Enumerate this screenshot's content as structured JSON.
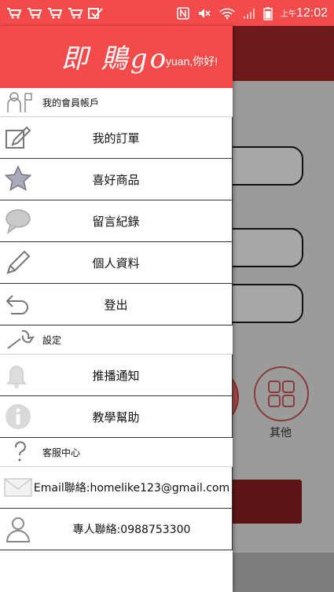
{
  "status_bar": {
    "time": "12:02",
    "ampm": "上午",
    "notification_icons": [
      "cart-icon",
      "cart-icon",
      "cart-icon",
      "cart-icon",
      "check-icon"
    ],
    "system_icons": [
      "nfc-icon",
      "mute-icon",
      "wifi-icon",
      "signal-icon",
      "battery-icon"
    ]
  },
  "drawer": {
    "logo": "即 鵙go",
    "greeting": "yuan,你好!",
    "sections": {
      "account": "我的會員帳戶",
      "settings": "設定",
      "support": "客服中心"
    },
    "account_items": [
      {
        "label": "我的訂單",
        "icon": "edit-icon"
      },
      {
        "label": "喜好商品",
        "icon": "star-icon"
      },
      {
        "label": "留言紀錄",
        "icon": "speech-bubble-icon"
      },
      {
        "label": "個人資料",
        "icon": "pencil-icon"
      },
      {
        "label": "登出",
        "icon": "undo-arrow-icon"
      }
    ],
    "settings_items": [
      {
        "label": "推播通知",
        "icon": "bell-icon"
      },
      {
        "label": "教學幫助",
        "icon": "info-icon"
      }
    ],
    "support_items": [
      {
        "label": "Email聯絡:homelike123@gmail.com",
        "icon": "envelope-icon"
      },
      {
        "label": "專人聯絡:0988753300",
        "icon": "person-icon"
      }
    ]
  },
  "background": {
    "other_label": "其他"
  },
  "colors": {
    "brand_red": "#f44a4a",
    "dim_header": "#6e1a1a"
  }
}
